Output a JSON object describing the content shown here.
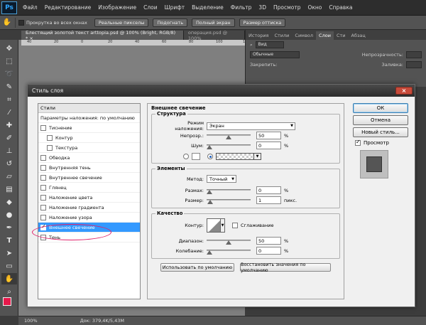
{
  "app": {
    "logo": "Ps"
  },
  "menu": [
    "Файл",
    "Редактирование",
    "Изображение",
    "Слои",
    "Шрифт",
    "Выделение",
    "Фильтр",
    "3D",
    "Просмотр",
    "Окно",
    "Справка"
  ],
  "options": {
    "scroll_all_label": "Прокрутка во всех окнах",
    "btn_actual_pixels": "Реальные пикселы",
    "btn_fit": "Подогнать",
    "btn_fullscreen": "Полный экран",
    "btn_print_size": "Размер оттиска"
  },
  "tabs": [
    {
      "label": "Блестящий золотой текст  arttopia.psd @ 100% (Bright, RGB/8) *  ×",
      "active": true
    },
    {
      "label": "операция.psd @ 100%",
      "active": false
    }
  ],
  "ruler_ticks": [
    "40",
    "20",
    "0",
    "20",
    "40",
    "60",
    "80",
    "100",
    "120"
  ],
  "right_panel": {
    "tabs": [
      "История",
      "Стили",
      "Символ",
      "Слои",
      "Сти",
      "Абзац"
    ],
    "active_tab": "Слои",
    "filter_label": "Вид",
    "blend_label": "Обычные",
    "opacity_label": "Непрозрачность:",
    "lock_label": "Закрепить:",
    "fill_label": "Заливка:"
  },
  "status": {
    "zoom": "100%",
    "doc": "Док: 379,4K/5,43M"
  },
  "dialog": {
    "title": "Стиль слоя",
    "close": "×",
    "styles_header": "Стили",
    "styles": [
      {
        "label": "Параметры наложения: по умолчанию",
        "checkbox": false,
        "sub": false,
        "checked": false,
        "selected": false
      },
      {
        "label": "Тиснение",
        "checkbox": true,
        "sub": false,
        "checked": false,
        "selected": false
      },
      {
        "label": "Контур",
        "checkbox": true,
        "sub": true,
        "checked": false,
        "selected": false
      },
      {
        "label": "Текстура",
        "checkbox": true,
        "sub": true,
        "checked": false,
        "selected": false
      },
      {
        "label": "Обводка",
        "checkbox": true,
        "sub": false,
        "checked": false,
        "selected": false
      },
      {
        "label": "Внутренняя тень",
        "checkbox": true,
        "sub": false,
        "checked": false,
        "selected": false
      },
      {
        "label": "Внутреннее свечение",
        "checkbox": true,
        "sub": false,
        "checked": false,
        "selected": false
      },
      {
        "label": "Глянец",
        "checkbox": true,
        "sub": false,
        "checked": false,
        "selected": false
      },
      {
        "label": "Наложение цвета",
        "checkbox": true,
        "sub": false,
        "checked": false,
        "selected": false
      },
      {
        "label": "Наложение градиента",
        "checkbox": true,
        "sub": false,
        "checked": false,
        "selected": false
      },
      {
        "label": "Наложение узора",
        "checkbox": true,
        "sub": false,
        "checked": false,
        "selected": false
      },
      {
        "label": "Внешнее свечение",
        "checkbox": true,
        "sub": false,
        "checked": true,
        "selected": true
      },
      {
        "label": "Тень",
        "checkbox": true,
        "sub": false,
        "checked": false,
        "selected": false
      }
    ],
    "panel_title": "Внешнее свечение",
    "structure": {
      "title": "Структура",
      "blend_label": "Режим наложения:",
      "blend_value": "Экран",
      "opacity_label": "Непрозр.:",
      "opacity_value": "50",
      "opacity_fraction": 0.5,
      "noise_label": "Шум:",
      "noise_value": "0",
      "noise_fraction": 0.0,
      "unit": "%"
    },
    "elements": {
      "title": "Элементы",
      "method_label": "Метод:",
      "method_value": "Точный",
      "spread_label": "Размах:",
      "spread_value": "0",
      "spread_fraction": 0.0,
      "size_label": "Размер:",
      "size_value": "1",
      "size_fraction": 0.01,
      "unit_pct": "%",
      "unit_px": "пикс."
    },
    "quality": {
      "title": "Качество",
      "contour_label": "Контур:",
      "antialias_label": "Сглаживание",
      "range_label": "Диапазон:",
      "range_value": "50",
      "range_fraction": 0.5,
      "jitter_label": "Колебание:",
      "jitter_value": "0",
      "jitter_fraction": 0.0,
      "unit": "%"
    },
    "btn_make_default": "Использовать по умолчанию",
    "btn_reset_default": "Восстановить значения по умолчанию",
    "btn_ok": "ОК",
    "btn_cancel": "Отмена",
    "btn_new_style": "Новый стиль...",
    "preview_label": "Просмотр",
    "preview_checked": true
  }
}
